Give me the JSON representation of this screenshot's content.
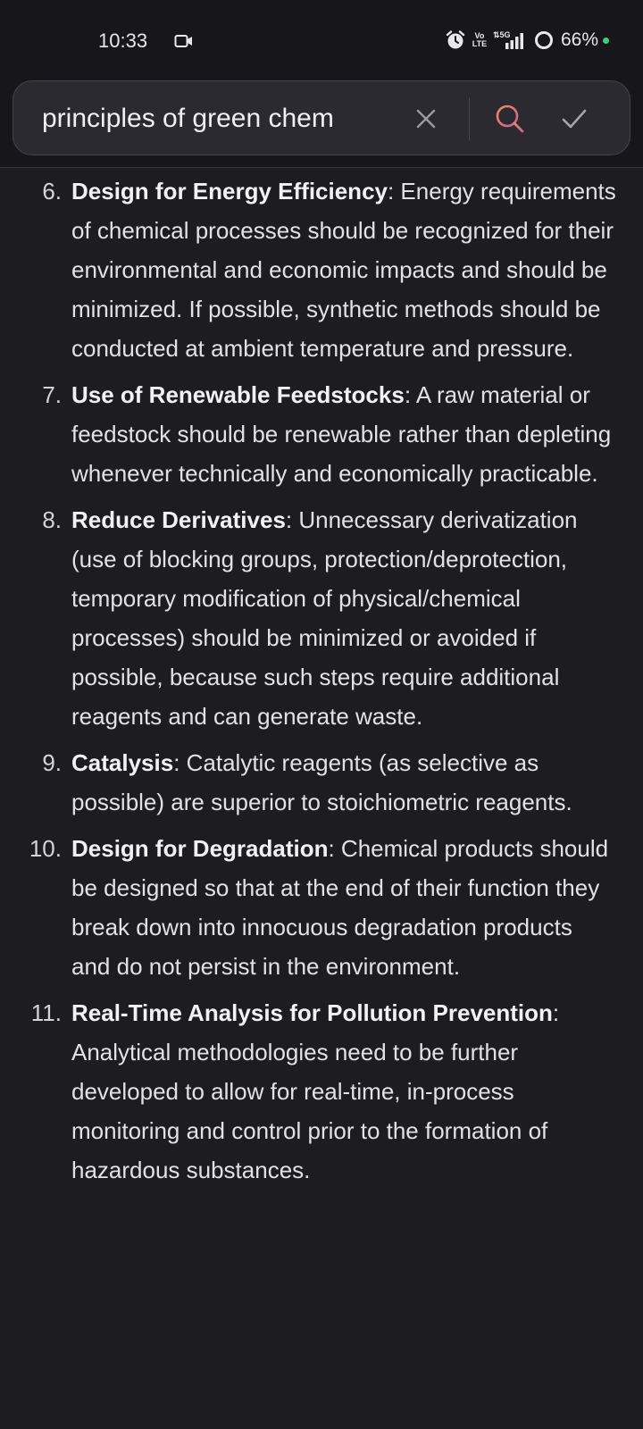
{
  "status_bar": {
    "time": "10:33",
    "volte_line1": "Vo",
    "volte_line2": "LTE",
    "network": "5G",
    "battery": "66%",
    "dot_color": "#3ccf7a"
  },
  "search": {
    "query": "principles of green chem",
    "icons": [
      "close-icon",
      "search-icon",
      "check-icon"
    ],
    "search_icon_color": "#e8607a"
  },
  "items": [
    {
      "number": "6.",
      "title": "Design for Energy Efficiency",
      "body": ": Energy requirements of chemical processes should be recognized for their environmental and economic impacts and should be minimized. If possible, synthetic methods should be conducted at ambient temperature and pressure."
    },
    {
      "number": "7.",
      "title": "Use of Renewable Feedstocks",
      "body": ": A raw material or feedstock should be renewable rather than depleting whenever technically and economically practicable."
    },
    {
      "number": "8.",
      "title": "Reduce Derivatives",
      "body": ": Unnecessary derivatization (use of blocking groups, protection/deprotection, temporary modification of physical/chemical processes) should be minimized or avoided if possible, because such steps require additional reagents and can generate waste."
    },
    {
      "number": "9.",
      "title": "Catalysis",
      "body": ": Catalytic reagents (as selective as possible) are superior to stoichiometric reagents."
    },
    {
      "number": "10.",
      "title": "Design for Degradation",
      "body": ": Chemical products should be designed so that at the end of their function they break down into innocuous degradation products and do not persist in the environment."
    },
    {
      "number": "11.",
      "title": "Real-Time Analysis for Pollution Prevention",
      "body": ": Analytical methodologies need to be further developed to allow for real-time, in-process monitoring and control prior to the formation of hazardous substances."
    }
  ]
}
